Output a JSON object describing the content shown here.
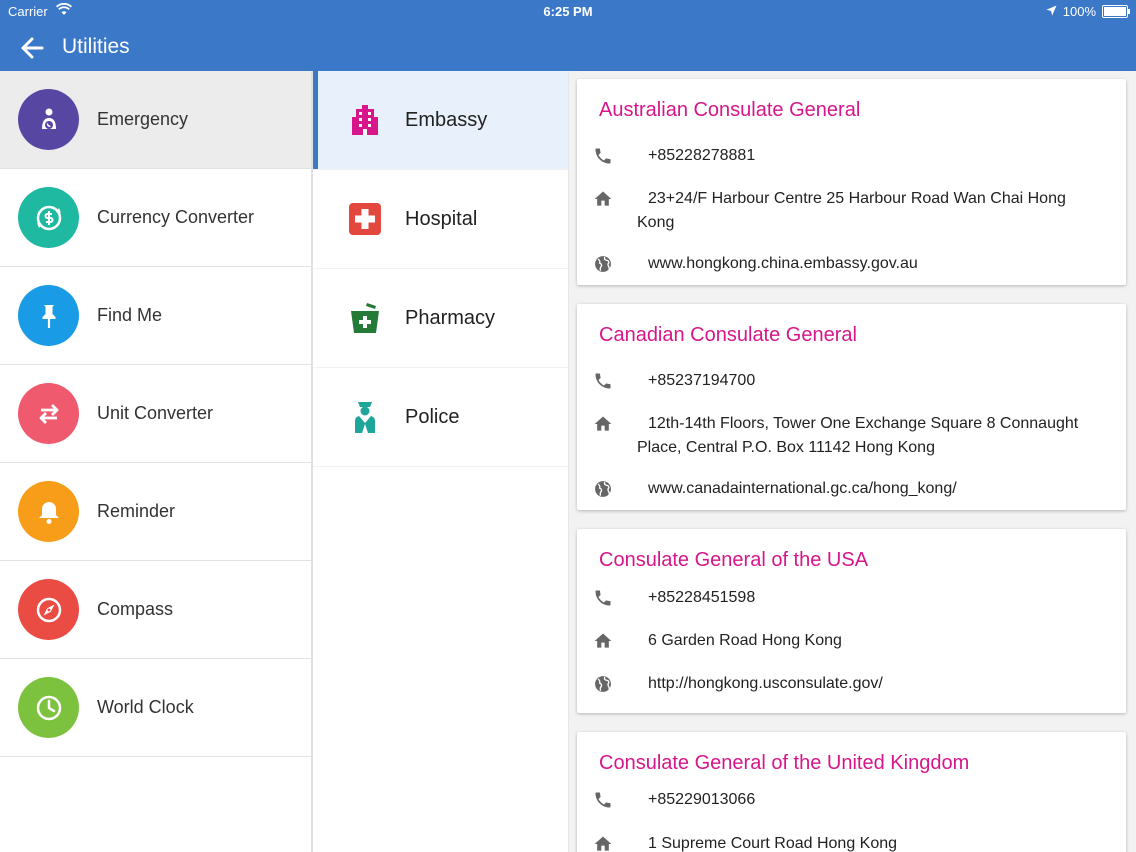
{
  "status_bar": {
    "carrier": "Carrier",
    "time": "6:25 PM",
    "battery": "100%"
  },
  "header": {
    "title": "Utilities"
  },
  "categories": [
    {
      "label": "Emergency",
      "color": "#5747a3",
      "icon": "emergency-icon",
      "selected": true
    },
    {
      "label": "Currency Converter",
      "color": "#1fb8a0",
      "icon": "currency-icon"
    },
    {
      "label": "Find Me",
      "color": "#1a9be6",
      "icon": "pin-icon"
    },
    {
      "label": "Unit Converter",
      "color": "#ef5a6f",
      "icon": "swap-arrows-icon"
    },
    {
      "label": "Reminder",
      "color": "#f79d1a",
      "icon": "bell-icon"
    },
    {
      "label": "Compass",
      "color": "#ea4b43",
      "icon": "compass-icon"
    },
    {
      "label": "World Clock",
      "color": "#7cc23e",
      "icon": "clock-icon"
    }
  ],
  "subcategories": [
    {
      "label": "Embassy",
      "color": "#d6168a",
      "icon": "building-icon",
      "selected": true
    },
    {
      "label": "Hospital",
      "color": "#e3483f",
      "icon": "hospital-cross-icon"
    },
    {
      "label": "Pharmacy",
      "color": "#247a36",
      "icon": "pharmacy-icon"
    },
    {
      "label": "Police",
      "color": "#1fa69a",
      "icon": "police-icon"
    }
  ],
  "embassies": [
    {
      "name": "Australian Consulate General",
      "phone": "+85228278881",
      "address": "23+24/F Harbour Centre 25 Harbour Road Wan Chai Hong Kong",
      "website": "www.hongkong.china.embassy.gov.au"
    },
    {
      "name": "Canadian Consulate General",
      "phone": "+85237194700",
      "address": "12th-14th Floors, Tower One Exchange Square 8 Connaught Place, Central P.O. Box 11142 Hong Kong",
      "website": "www.canadainternational.gc.ca/hong_kong/"
    },
    {
      "name": "Consulate General of the USA",
      "phone": "+85228451598",
      "address": "6 Garden Road Hong Kong",
      "website": "http://hongkong.usconsulate.gov/"
    },
    {
      "name": "Consulate General of the United Kingdom",
      "phone": "+85229013066",
      "address": "1 Supreme Court Road Hong Kong"
    }
  ],
  "colors": {
    "header_bg": "#3b78c8",
    "title_accent": "#d6168a"
  }
}
